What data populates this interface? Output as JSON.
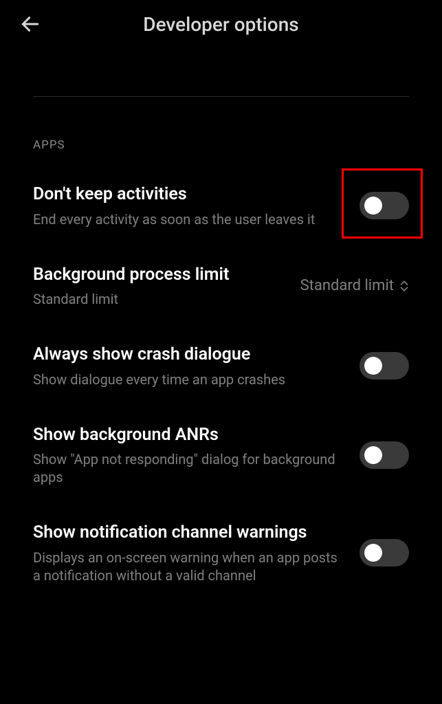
{
  "header": {
    "title": "Developer options"
  },
  "section": {
    "label": "APPS"
  },
  "settings": {
    "dont_keep_activities": {
      "title": "Don't keep activities",
      "subtitle": "End every activity as soon as the user leaves it"
    },
    "bg_process_limit": {
      "title": "Background process limit",
      "subtitle": "Standard limit",
      "value": "Standard limit"
    },
    "crash_dialogue": {
      "title": "Always show crash dialogue",
      "subtitle": "Show dialogue every time an app crashes"
    },
    "bg_anrs": {
      "title": "Show background ANRs",
      "subtitle": "Show \"App not responding\" dialog for background apps"
    },
    "notification_warnings": {
      "title": "Show notification channel warnings",
      "subtitle": "Displays an on-screen warning when an app posts a notification without a valid channel"
    }
  }
}
